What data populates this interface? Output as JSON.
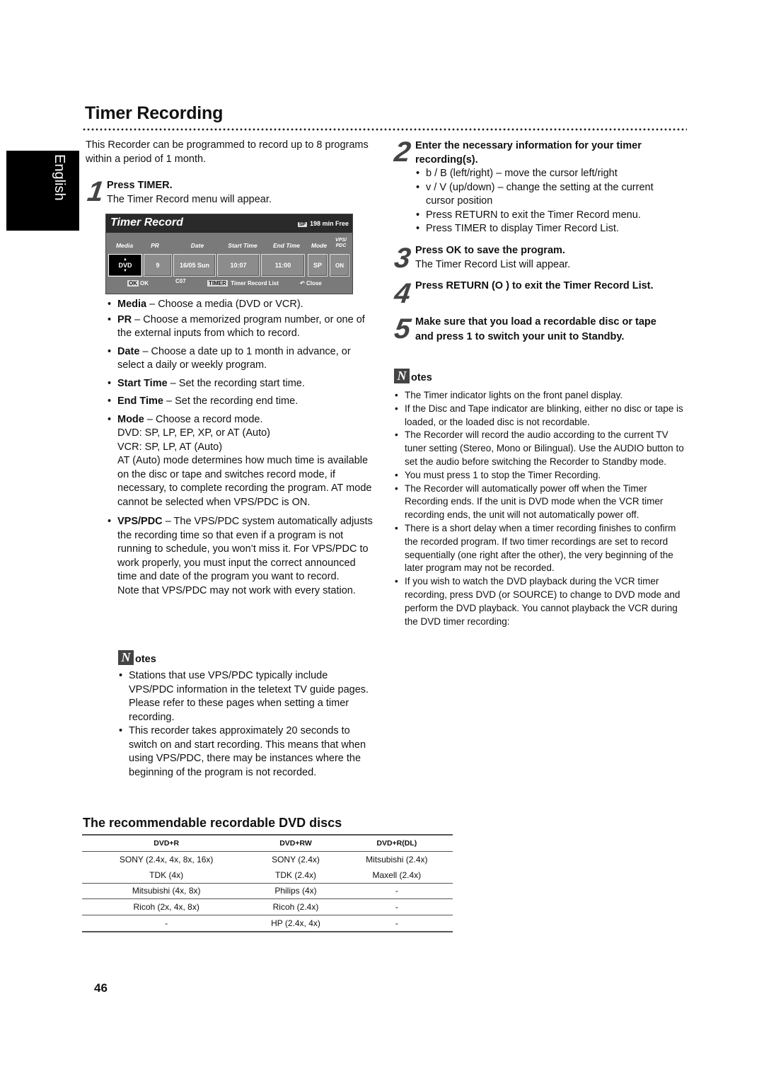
{
  "page": {
    "title": "Timer Recording",
    "language_tab": "English",
    "page_number": "46",
    "intro": "This Recorder can be programmed to record up to 8 programs within a period of 1 month."
  },
  "steps": [
    {
      "num": "1",
      "heading": "Press TIMER.",
      "text": "The Timer Record menu will appear."
    },
    {
      "num": "2",
      "heading": "Enter the necessary information for your timer recording(s).",
      "bullets": [
        "b  / B  (left/right) – move the cursor left/right",
        "v  / V  (up/down) – change the setting at the current cursor position",
        "Press RETURN to exit the Timer Record menu.",
        "Press TIMER to display Timer Record List."
      ]
    },
    {
      "num": "3",
      "heading": "Press OK to save the program.",
      "text": "The Timer Record List will appear."
    },
    {
      "num": "4",
      "heading": "Press RETURN (O  ) to exit the Timer Record List."
    },
    {
      "num": "5",
      "heading": "Make sure that you load a recordable disc or tape and press 1  to switch your unit to Standby."
    }
  ],
  "menu": {
    "title": "Timer Record",
    "mode_badge": "SP",
    "free": "198  min Free",
    "columns": [
      "Media",
      "PR",
      "Date",
      "Start Time",
      "End Time",
      "Mode",
      "VPS/ PDC"
    ],
    "values": [
      "DVD",
      "9",
      "16/05 Sun",
      "10:07",
      "11:00",
      "SP",
      "ON"
    ],
    "footer": {
      "ok_key": "OK",
      "ok_label": "OK",
      "channel": "C07",
      "timer_key": "TIMER",
      "timer_label": "Timer Record List",
      "close_label": "Close"
    }
  },
  "fields": [
    {
      "term": "Media",
      "desc": " – Choose a media (DVD or VCR)."
    },
    {
      "term": "PR",
      "desc": " – Choose a memorized program number, or one of the external inputs from which to record."
    },
    {
      "term": "Date",
      "desc": " – Choose a date up to 1 month in advance, or select a daily or weekly program."
    },
    {
      "term": "Start Time",
      "desc": " – Set the recording start time."
    },
    {
      "term": "End Time",
      "desc": " – Set the recording end time."
    },
    {
      "term": "Mode",
      "desc": " – Choose a record mode.",
      "extra": [
        "DVD: SP, LP, EP, XP, or AT (Auto)",
        "VCR: SP, LP, AT (Auto)",
        "AT (Auto) mode determines how much time is available on the disc or tape and switches record mode, if necessary, to complete recording the program. AT mode cannot be selected when VPS/PDC is ON."
      ]
    },
    {
      "term": "VPS/PDC",
      "desc": " – The VPS/PDC system automatically adjusts the recording time so that even if a program is not running to schedule, you won’t miss it. For VPS/PDC to work properly, you must input the correct announced time and date of the program you want to record.",
      "extra": [
        "Note that VPS/PDC may not work with every station."
      ]
    }
  ],
  "notes_left": {
    "icon_letter": "N",
    "heading": "otes",
    "items": [
      "Stations that use VPS/PDC typically include VPS/PDC information in the teletext TV guide pages. Please refer to these pages when setting a timer recording.",
      "This recorder takes approximately 20 seconds to switch on and start recording. This means that when using VPS/PDC, there may be instances where the beginning of the program is not recorded."
    ]
  },
  "notes_right": {
    "icon_letter": "N",
    "heading": "otes",
    "items": [
      "The Timer indicator lights on the front panel display.",
      "If the Disc and Tape indicator are blinking, either no disc or tape is loaded, or the loaded disc is not recordable.",
      "The Recorder will record the audio according to the current TV tuner setting (Stereo, Mono or Bilingual). Use the AUDIO button to set the audio before switching the Recorder to Standby mode.",
      "You must press 1  to stop the Timer Recording.",
      "The Recorder will automatically power off when the Timer Recording ends. If the unit is DVD mode when the VCR timer recording ends, the unit will not automatically power off.",
      "There is a short delay when a timer recording finishes to confirm the recorded program. If two timer recordings are set to record sequentially (one right after the other), the very beginning of the later program may not be recorded.",
      "If you wish to watch the DVD playback during the VCR timer recording, press DVD (or SOURCE) to change to DVD mode and perform the DVD playback. You cannot playback the VCR during the DVD timer recording:"
    ]
  },
  "discs": {
    "heading": "The recommendable recordable DVD discs",
    "columns": [
      "DVD+R",
      "DVD+RW",
      "DVD+R(DL)"
    ],
    "rows": [
      [
        "SONY (2.4x, 4x, 8x, 16x)",
        "SONY (2.4x)",
        "Mitsubishi (2.4x)"
      ],
      [
        "TDK (4x)",
        "TDK (2.4x)",
        "Maxell (2.4x)"
      ],
      [
        "Mitsubishi (4x, 8x)",
        "Philips (4x)",
        "-"
      ],
      [
        "Ricoh (2x, 4x, 8x)",
        "Ricoh (2.4x)",
        "-"
      ],
      [
        "-",
        "HP (2.4x, 4x)",
        "-"
      ]
    ]
  }
}
